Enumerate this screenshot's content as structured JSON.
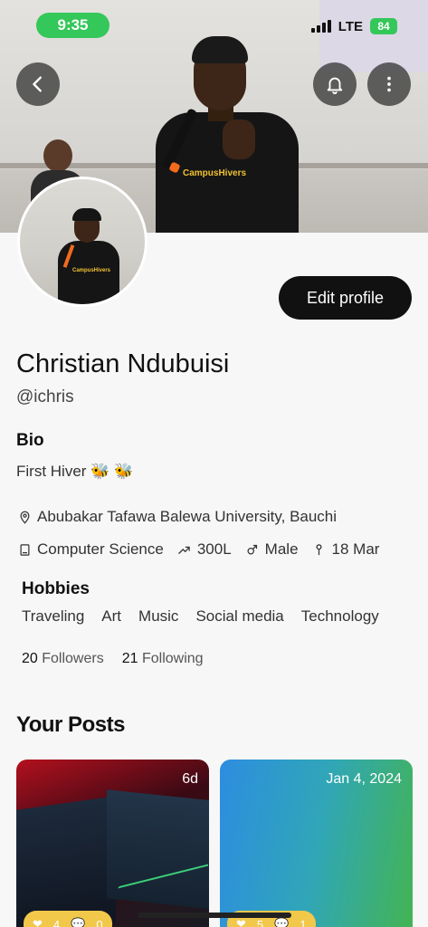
{
  "status_bar": {
    "time": "9:35",
    "network": "LTE",
    "battery": "84"
  },
  "icons": {
    "back": "chevron-left-icon",
    "notifications": "bell-icon",
    "more": "vertical-dots-icon",
    "location": "location-pin-icon",
    "department": "book-icon",
    "level": "trend-up-icon",
    "gender": "gender-icon",
    "birthday": "cake-icon"
  },
  "profile": {
    "edit_label": "Edit profile",
    "name": "Christian Ndubuisi",
    "handle": "@ichris",
    "bio_title": "Bio",
    "bio": "First Hiver 🐝 🐝",
    "university": "Abubakar Tafawa Balewa University, Bauchi",
    "department": "Computer Science",
    "level": "300L",
    "gender": "Male",
    "birthday": "18 Mar",
    "cover_logo": "CampusHivers"
  },
  "hobbies": {
    "title": "Hobbies",
    "items": [
      "Traveling",
      "Art",
      "Music",
      "Social media",
      "Technology"
    ]
  },
  "stats": {
    "followers_count": "20",
    "followers_label": "Followers",
    "following_count": "21",
    "following_label": "Following"
  },
  "posts": {
    "title": "Your Posts",
    "items": [
      {
        "date": "6d",
        "likes": "4",
        "comments": "0"
      },
      {
        "date": "Jan 4, 2024",
        "likes": "5",
        "comments": "1"
      }
    ]
  },
  "colors": {
    "accent": "#34c759",
    "primary_button": "#111111",
    "post_stats": "#f2c84b"
  }
}
